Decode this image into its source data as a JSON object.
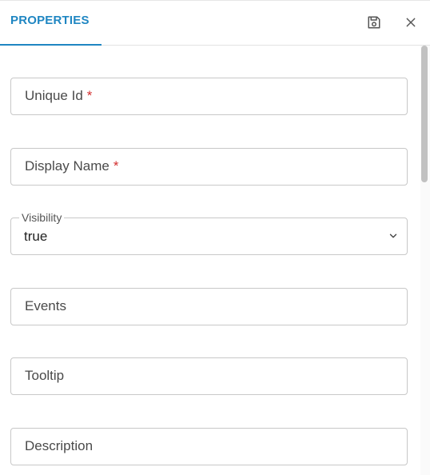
{
  "header": {
    "tab_label": "PROPERTIES",
    "save_icon": "save-icon",
    "close_icon": "close-icon",
    "accent_color": "#1f86c2"
  },
  "fields": {
    "unique_id": {
      "label": "Unique Id",
      "required_mark": "*"
    },
    "display_name": {
      "label": "Display Name",
      "required_mark": "*"
    },
    "visibility": {
      "legend": "Visibility",
      "value": "true"
    },
    "events": {
      "label": "Events"
    },
    "tooltip": {
      "label": "Tooltip"
    },
    "description": {
      "label": "Description"
    }
  },
  "colors": {
    "required": "#d32f2f",
    "border": "#c8c8c8"
  }
}
